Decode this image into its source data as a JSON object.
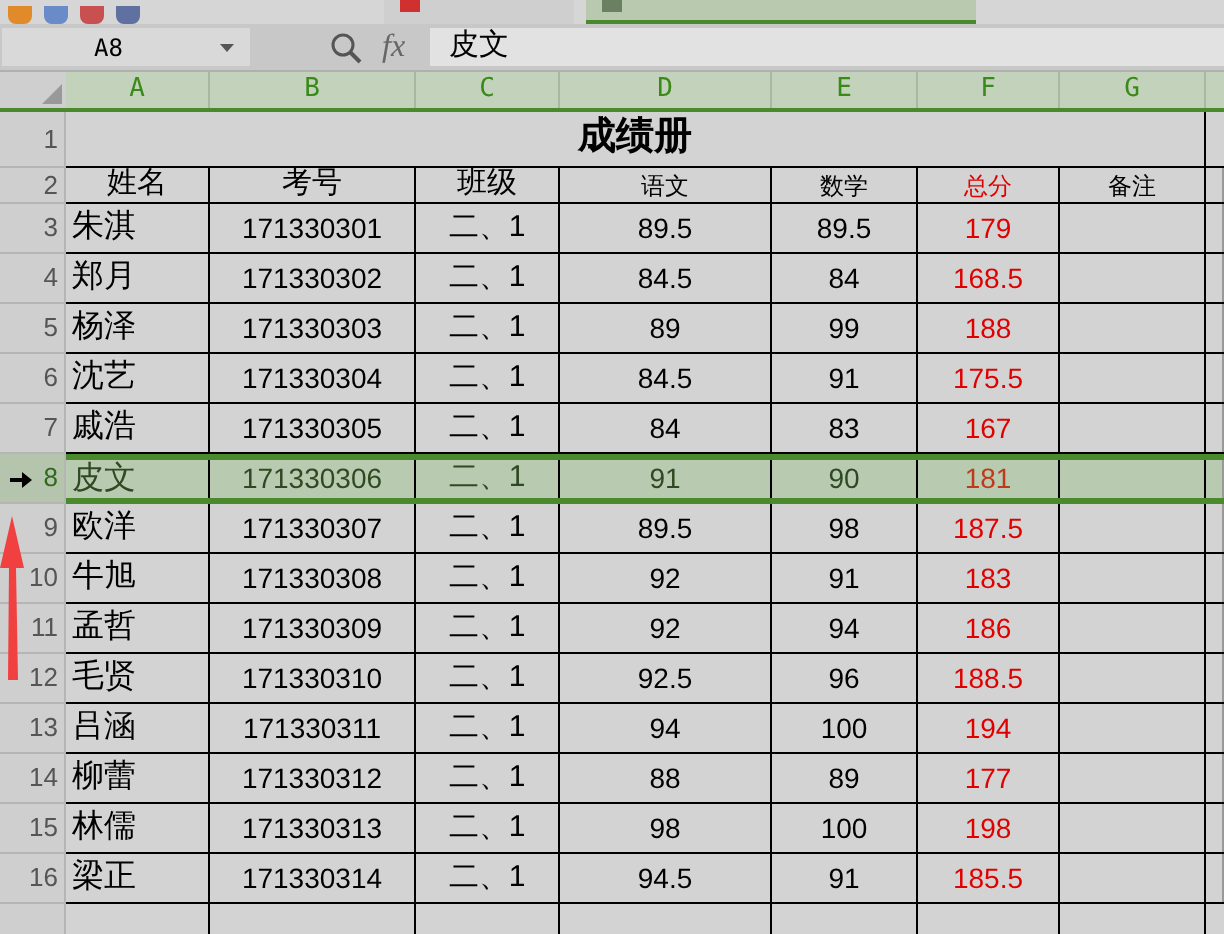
{
  "document_tabs": [
    {
      "selected": false
    },
    {
      "selected": true
    }
  ],
  "formula_bar": {
    "name_box": "A8",
    "function_label": "fx",
    "content": "皮文"
  },
  "columns": [
    {
      "label": "A",
      "highlighted": true
    },
    {
      "label": "B",
      "highlighted": true
    },
    {
      "label": "C",
      "highlighted": true
    },
    {
      "label": "D",
      "highlighted": true
    },
    {
      "label": "E",
      "highlighted": true
    },
    {
      "label": "F",
      "highlighted": true
    },
    {
      "label": "G",
      "highlighted": true
    }
  ],
  "rows": [
    {
      "number": "1",
      "kind": "title",
      "selected": false,
      "title": "成绩册"
    },
    {
      "number": "2",
      "kind": "header",
      "selected": false,
      "labels": [
        {
          "text": "姓名",
          "color": "#000000"
        },
        {
          "text": "考号",
          "color": "#000000"
        },
        {
          "text": "班级",
          "color": "#000000"
        },
        {
          "text": "语文",
          "color": "#000000"
        },
        {
          "text": "数学",
          "color": "#000000"
        },
        {
          "text": "总分",
          "color": "#e00000"
        },
        {
          "text": "备注",
          "color": "#000000"
        }
      ]
    },
    {
      "number": "3",
      "kind": "data",
      "selected": false,
      "name": "朱淇",
      "id": "171330301",
      "class": "二、1",
      "chinese": "89.5",
      "math": "89.5",
      "total": "179"
    },
    {
      "number": "4",
      "kind": "data",
      "selected": false,
      "name": "郑月",
      "id": "171330302",
      "class": "二、1",
      "chinese": "84.5",
      "math": "84",
      "total": "168.5"
    },
    {
      "number": "5",
      "kind": "data",
      "selected": false,
      "name": "杨泽",
      "id": "171330303",
      "class": "二、1",
      "chinese": "89",
      "math": "99",
      "total": "188"
    },
    {
      "number": "6",
      "kind": "data",
      "selected": false,
      "name": "沈艺",
      "id": "171330304",
      "class": "二、1",
      "chinese": "84.5",
      "math": "91",
      "total": "175.5"
    },
    {
      "number": "7",
      "kind": "data",
      "selected": false,
      "name": "戚浩",
      "id": "171330305",
      "class": "二、1",
      "chinese": "84",
      "math": "83",
      "total": "167"
    },
    {
      "number": "8",
      "kind": "data",
      "selected": true,
      "name": "皮文",
      "id": "171330306",
      "class": "二、1",
      "chinese": "91",
      "math": "90",
      "total": "181"
    },
    {
      "number": "9",
      "kind": "data",
      "selected": false,
      "name": "欧洋",
      "id": "171330307",
      "class": "二、1",
      "chinese": "89.5",
      "math": "98",
      "total": "187.5"
    },
    {
      "number": "10",
      "kind": "data",
      "selected": false,
      "name": "牛旭",
      "id": "171330308",
      "class": "二、1",
      "chinese": "92",
      "math": "91",
      "total": "183"
    },
    {
      "number": "11",
      "kind": "data",
      "selected": false,
      "name": "孟哲",
      "id": "171330309",
      "class": "二、1",
      "chinese": "92",
      "math": "94",
      "total": "186"
    },
    {
      "number": "12",
      "kind": "data",
      "selected": false,
      "name": "毛贤",
      "id": "171330310",
      "class": "二、1",
      "chinese": "92.5",
      "math": "96",
      "total": "188.5"
    },
    {
      "number": "13",
      "kind": "data",
      "selected": false,
      "name": "吕涵",
      "id": "171330311",
      "class": "二、1",
      "chinese": "94",
      "math": "100",
      "total": "194"
    },
    {
      "number": "14",
      "kind": "data",
      "selected": false,
      "name": "柳蕾",
      "id": "171330312",
      "class": "二、1",
      "chinese": "88",
      "math": "89",
      "total": "177"
    },
    {
      "number": "15",
      "kind": "data",
      "selected": false,
      "name": "林儒",
      "id": "171330313",
      "class": "二、1",
      "chinese": "98",
      "math": "100",
      "total": "198"
    },
    {
      "number": "16",
      "kind": "data",
      "selected": false,
      "name": "梁正",
      "id": "171330314",
      "class": "二、1",
      "chinese": "94.5",
      "math": "91",
      "total": "185.5"
    }
  ]
}
